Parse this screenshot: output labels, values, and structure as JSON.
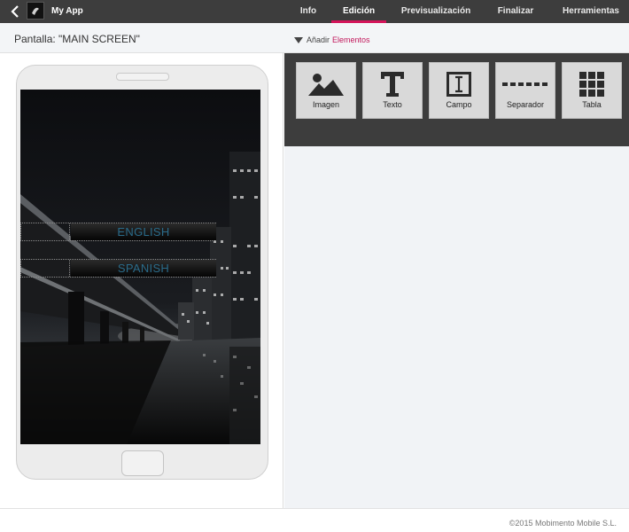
{
  "header": {
    "app_name": "My App",
    "tabs": [
      {
        "label": "Info",
        "active": false
      },
      {
        "label": "Edición",
        "active": true
      },
      {
        "label": "Previsualización",
        "active": false
      },
      {
        "label": "Finalizar",
        "active": false
      },
      {
        "label": "Herramientas",
        "active": false
      }
    ],
    "accent_color": "#d4145a"
  },
  "subbar": {
    "screen_label": "Pantalla: \"MAIN SCREEN\"",
    "add_prefix": "Añadir",
    "add_link": "Elementos"
  },
  "phone": {
    "buttons": [
      {
        "label": "ENGLISH"
      },
      {
        "label": "SPANISH"
      }
    ],
    "button_text_color": "#2a6b8a"
  },
  "palette": {
    "tools": [
      {
        "label": "Imagen",
        "icon": "image-icon"
      },
      {
        "label": "Texto",
        "icon": "text-icon"
      },
      {
        "label": "Campo",
        "icon": "field-icon"
      },
      {
        "label": "Separador",
        "icon": "separator-icon"
      },
      {
        "label": "Tabla",
        "icon": "table-icon"
      }
    ]
  },
  "footer": {
    "copyright": "©2015 Mobimento Mobile S.L."
  }
}
